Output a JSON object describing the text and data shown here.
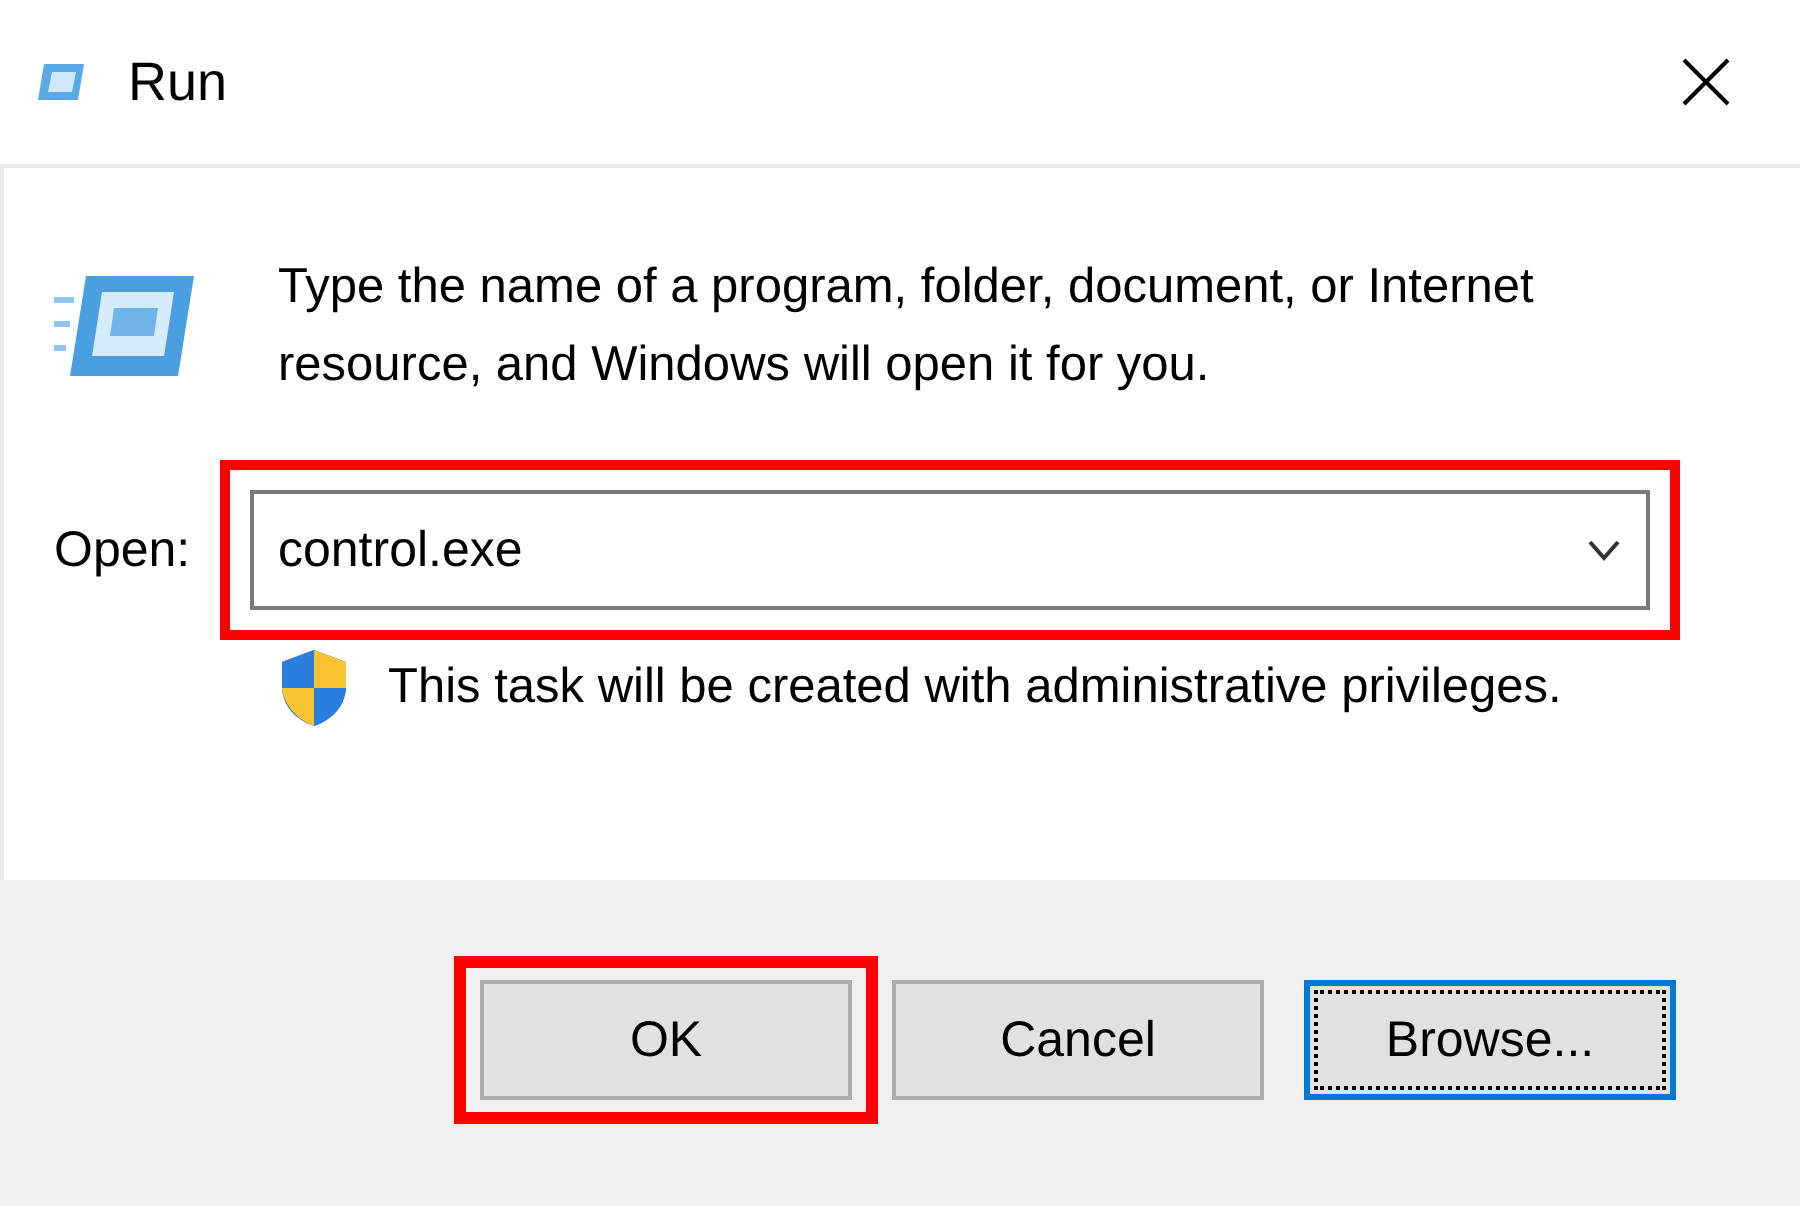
{
  "window": {
    "title": "Run"
  },
  "description": "Type the name of a program, folder, document, or Internet resource, and Windows will open it for you.",
  "open": {
    "label": "Open:",
    "value": "control.exe",
    "highlighted": true
  },
  "admin_note": "This task will be created with administrative privileges.",
  "buttons": [
    {
      "label": "OK",
      "focused": false,
      "highlighted": true
    },
    {
      "label": "Cancel",
      "focused": false,
      "highlighted": false
    },
    {
      "label": "Browse...",
      "focused": true,
      "highlighted": false
    }
  ]
}
